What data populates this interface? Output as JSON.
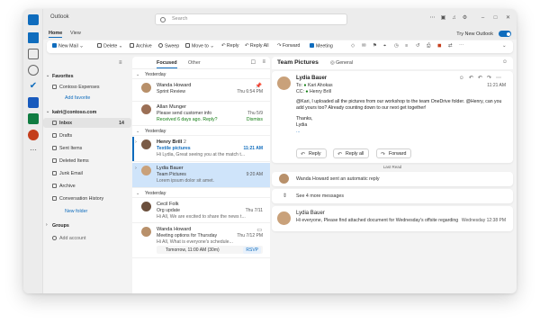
{
  "window": {
    "app_title": "Outlook"
  },
  "search": {
    "placeholder": "Search"
  },
  "menu": {
    "home": "Home",
    "view": "View"
  },
  "try_new": "Try New Outlook",
  "toolbar": {
    "new_mail": "New Mail",
    "delete": "Delete",
    "archive": "Archive",
    "sweep": "Sweep",
    "move_to": "Move to",
    "reply": "Reply",
    "reply_all": "Reply All",
    "forward": "Forward",
    "meeting": "Meeting"
  },
  "folders": {
    "favorites": "Favorites",
    "contoso_expenses": "Contoso Expenses",
    "add_favorite": "Add favorite",
    "account": "katri@contoso.com",
    "inbox": "Inbox",
    "inbox_count": "14",
    "drafts": "Drafts",
    "sent": "Sent Items",
    "deleted": "Deleted Items",
    "junk": "Junk Email",
    "archive": "Archive",
    "conversation_history": "Conversation History",
    "new_folder": "New folder",
    "groups": "Groups",
    "add_account": "Add account"
  },
  "mail_tabs": {
    "focused": "Focused",
    "other": "Other"
  },
  "groups": {
    "yesterday": "Yesterday"
  },
  "messages": [
    {
      "from": "Wanda Howard",
      "subject": "Sprint Review",
      "time": "Thu 6:54 PM"
    },
    {
      "from": "Allan Munger",
      "subject": "Please send customer info",
      "preview": "Received 6 days ago. Reply?",
      "time": "Thu 5/9",
      "action": "Dismiss"
    },
    {
      "from": "Henry Brill",
      "count": "2",
      "subject": "Textile pictures",
      "preview": "Hi Lydia, Great seeing you at the match t...",
      "time": "11:21 AM"
    },
    {
      "from": "Lydia Bauer",
      "subject": "Team Pictures",
      "preview": "Lorem ipsum dolor sit amet.",
      "time": "9:20 AM"
    },
    {
      "from": "Cecil Folk",
      "subject": "Org update",
      "preview": "Hi All, We are excited to share the news t...",
      "time": "Thu 7/11"
    },
    {
      "from": "Wanda Howard",
      "subject": "Meeting options for Thursday",
      "preview": "Hi All, What is everyone's schedule...",
      "time": "Thu 7/12 PM",
      "invite": "Tomorrow, 11:00 AM (30m)",
      "rsvp": "RSVP"
    }
  ],
  "reading": {
    "title": "Team Pictures",
    "channel": "General",
    "email": {
      "from": "Lydia Bauer",
      "to_label": "To:",
      "to": "Kari Ahokas",
      "cc_label": "CC:",
      "cc": "Henry Brill",
      "time": "11:21 AM",
      "body1": "@Kari, I uploaded all the pictures from our workshop to the team OneDrive folder. @Henry, can you add yours too? Already counting down to our next get together!",
      "body2": "Thanks,",
      "body3": "Lydia",
      "more": "...",
      "reply": "Reply",
      "reply_all": "Reply all",
      "forward": "Forward"
    },
    "last_read": "Last Read",
    "auto_reply": "Wanda Howard sent an automatic reply",
    "see_more": "See 4 more messages",
    "second": {
      "from": "Lydia Bauer",
      "preview": "Hi everyone, Please find attached document for Wednesday's offsite regarding...",
      "time": "Wednesday 12:38 PM"
    }
  },
  "colors": {
    "accent": "#0f6cbd",
    "selected_row": "#cfe4fa",
    "green": "#107c10"
  }
}
